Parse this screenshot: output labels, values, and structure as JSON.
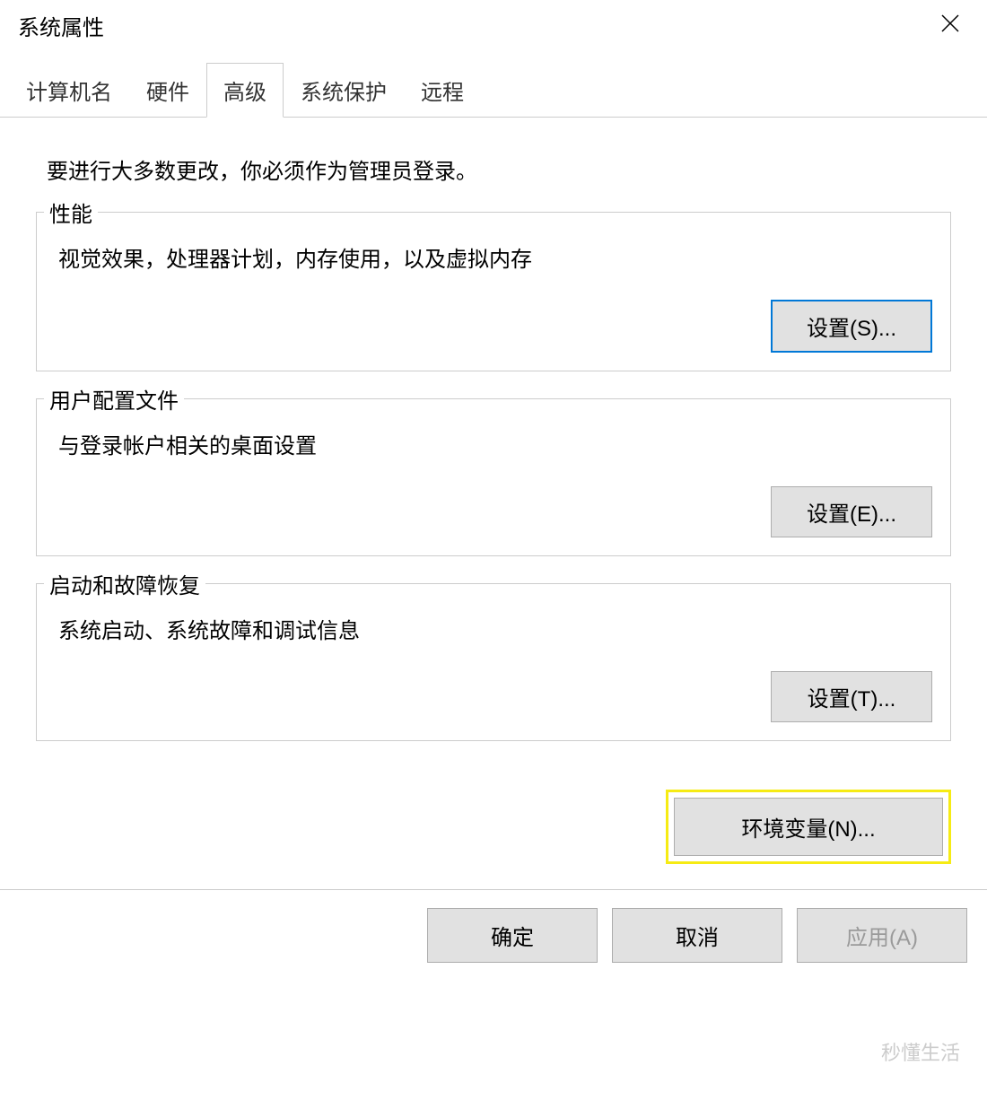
{
  "window": {
    "title": "系统属性"
  },
  "tabs": {
    "computer_name": "计算机名",
    "hardware": "硬件",
    "advanced": "高级",
    "system_protection": "系统保护",
    "remote": "远程"
  },
  "content": {
    "intro": "要进行大多数更改，你必须作为管理员登录。",
    "performance": {
      "legend": "性能",
      "desc": "视觉效果，处理器计划，内存使用，以及虚拟内存",
      "button": "设置(S)..."
    },
    "user_profiles": {
      "legend": "用户配置文件",
      "desc": "与登录帐户相关的桌面设置",
      "button": "设置(E)..."
    },
    "startup": {
      "legend": "启动和故障恢复",
      "desc": "系统启动、系统故障和调试信息",
      "button": "设置(T)..."
    },
    "env_vars_button": "环境变量(N)..."
  },
  "footer": {
    "ok": "确定",
    "cancel": "取消",
    "apply": "应用(A)"
  },
  "watermark": "秒懂生活"
}
